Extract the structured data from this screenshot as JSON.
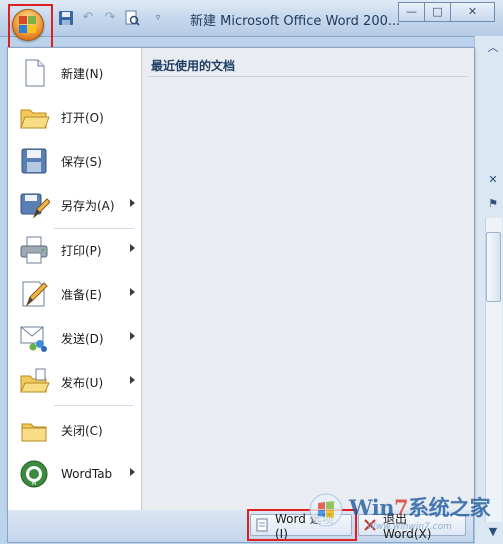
{
  "window": {
    "title": "新建 Microsoft Office Word 200...",
    "minimize_glyph": "—",
    "maximize_glyph": "□",
    "close_glyph": "✕"
  },
  "quick_access": {
    "icons": [
      "save-icon",
      "undo-icon",
      "redo-icon",
      "print-preview-icon",
      "customize-dropdown-icon"
    ]
  },
  "office_menu": {
    "items": [
      {
        "label": "新建(N)",
        "icon": "new-document-icon",
        "has_submenu": false
      },
      {
        "label": "打开(O)",
        "icon": "open-folder-icon",
        "has_submenu": false
      },
      {
        "label": "保存(S)",
        "icon": "save-disk-icon",
        "has_submenu": false
      },
      {
        "label": "另存为(A)",
        "icon": "save-as-icon",
        "has_submenu": true
      },
      {
        "label": "打印(P)",
        "icon": "printer-icon",
        "has_submenu": true
      },
      {
        "label": "准备(E)",
        "icon": "prepare-icon",
        "has_submenu": true
      },
      {
        "label": "发送(D)",
        "icon": "send-icon",
        "has_submenu": true
      },
      {
        "label": "发布(U)",
        "icon": "publish-icon",
        "has_submenu": true
      },
      {
        "label": "关闭(C)",
        "icon": "close-folder-icon",
        "has_submenu": false
      },
      {
        "label": "WordTab",
        "icon": "wordtab-icon",
        "has_submenu": true
      }
    ],
    "recent_header": "最近使用的文档"
  },
  "footer": {
    "options_button": "Word 选项(I)",
    "exit_button": "退出 Word(X)"
  },
  "watermark": {
    "brand_pre": "Win",
    "brand_seven": "7",
    "brand_post": "系统之家",
    "url": "Www.winwin7.com"
  },
  "colors": {
    "highlight_box": "#e02020",
    "orb": "#f3a646",
    "menu_bg": "#ffffff",
    "recent_bg": "#e9edf2"
  }
}
